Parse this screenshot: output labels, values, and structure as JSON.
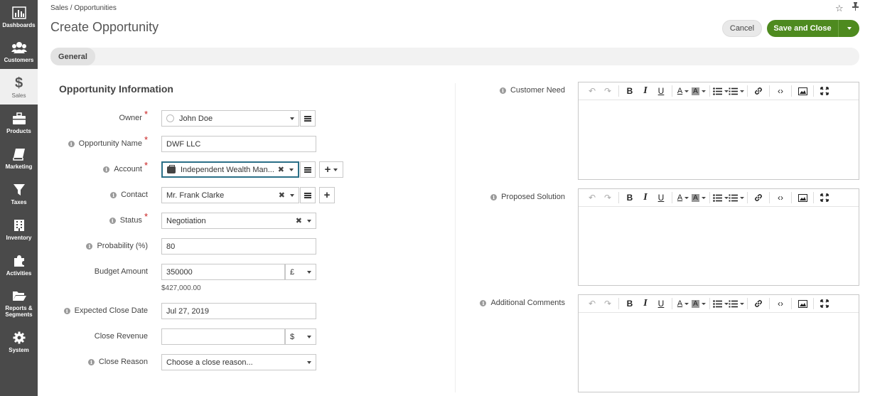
{
  "sidebar": {
    "items": [
      {
        "label": "Dashboards",
        "icon": "dashboards-icon"
      },
      {
        "label": "Customers",
        "icon": "customers-icon"
      },
      {
        "label": "Sales",
        "icon": "dollar-icon"
      },
      {
        "label": "Products",
        "icon": "briefcase-icon"
      },
      {
        "label": "Marketing",
        "icon": "book-icon"
      },
      {
        "label": "Taxes",
        "icon": "funnel-icon"
      },
      {
        "label": "Inventory",
        "icon": "building-icon"
      },
      {
        "label": "Activities",
        "icon": "puzzle-icon"
      },
      {
        "label": "Reports & Segments",
        "icon": "folder-icon"
      },
      {
        "label": "System",
        "icon": "gear-icon"
      }
    ],
    "active": "Sales",
    "dollar_glyph": "$"
  },
  "header": {
    "breadcrumb": "Sales / Opportunities",
    "title": "Create Opportunity",
    "cancel_label": "Cancel",
    "save_label": "Save and Close"
  },
  "tabs": {
    "general": "General"
  },
  "section": {
    "title": "Opportunity Information"
  },
  "form": {
    "owner": {
      "label": "Owner",
      "value": "John Doe"
    },
    "opportunity_name": {
      "label": "Opportunity Name",
      "value": "DWF LLC"
    },
    "account": {
      "label": "Account",
      "value": "Independent Wealth Man..."
    },
    "contact": {
      "label": "Contact",
      "value": "Mr. Frank Clarke"
    },
    "status": {
      "label": "Status",
      "value": "Negotiation"
    },
    "probability": {
      "label": "Probability (%)",
      "value": "80"
    },
    "budget_amount": {
      "label": "Budget Amount",
      "value": "350000",
      "currency": "£",
      "converted": "$427,000.00"
    },
    "expected_close_date": {
      "label": "Expected Close Date",
      "value": "Jul 27, 2019"
    },
    "close_revenue": {
      "label": "Close Revenue",
      "value": "",
      "currency": "$"
    },
    "close_reason": {
      "label": "Close Reason",
      "value": "Choose a close reason..."
    }
  },
  "editors": {
    "customer_need": {
      "label": "Customer Need"
    },
    "proposed_solution": {
      "label": "Proposed Solution"
    },
    "additional_comments": {
      "label": "Additional Comments"
    }
  },
  "glyphs": {
    "required": "*",
    "info": "i",
    "clear": "✖",
    "plus": "+",
    "star": "☆",
    "undo": "↶",
    "redo": "↷",
    "bold": "B",
    "italic": "I",
    "underline": "U",
    "font_color": "A",
    "bg_color": "A",
    "code": "‹›"
  },
  "colors": {
    "save": "#4e8a1f",
    "sidebar": "#4a4a4a",
    "required": "#c81e1e",
    "focus": "#2a6f87"
  }
}
